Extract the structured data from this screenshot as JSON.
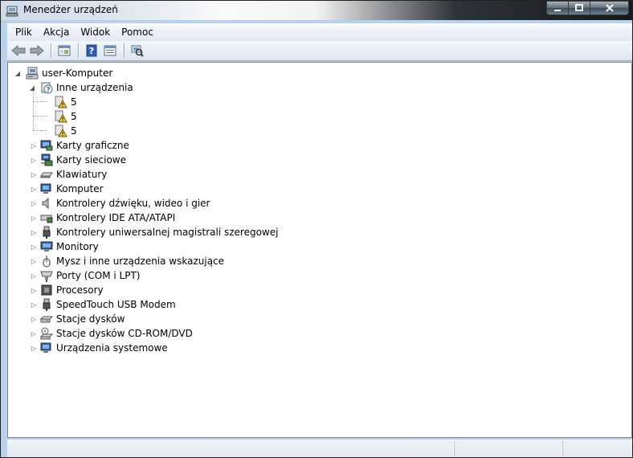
{
  "window": {
    "title": "Menedżer urządzeń",
    "caption_buttons": {
      "minimize": "▁",
      "maximize": "▢",
      "close": "✕"
    }
  },
  "menu": [
    "Plik",
    "Akcja",
    "Widok",
    "Pomoc"
  ],
  "toolbar": {
    "buttons": [
      "back-arrow-icon",
      "forward-arrow-icon",
      "console-tree-icon",
      "help-icon",
      "properties-icon",
      "scan-hardware-icon"
    ]
  },
  "tree": {
    "root": {
      "label": "user-Komputer",
      "icon": "computer-icon"
    },
    "other_devices": {
      "label": "Inne urządzenia",
      "children": [
        "5",
        "5",
        "5"
      ]
    },
    "categories": [
      {
        "label": "Karty graficzne",
        "icon": "display-adapter-icon"
      },
      {
        "label": "Karty sieciowe",
        "icon": "network-adapter-icon"
      },
      {
        "label": "Klawiatury",
        "icon": "keyboard-icon"
      },
      {
        "label": "Komputer",
        "icon": "computer-monitor-icon"
      },
      {
        "label": "Kontrolery dźwięku, wideo i gier",
        "icon": "speaker-icon"
      },
      {
        "label": "Kontrolery IDE ATA/ATAPI",
        "icon": "ide-controller-icon"
      },
      {
        "label": "Kontrolery uniwersalnej magistrali szeregowej",
        "icon": "usb-icon"
      },
      {
        "label": "Monitory",
        "icon": "monitor-icon"
      },
      {
        "label": "Mysz i inne urządzenia wskazujące",
        "icon": "mouse-icon"
      },
      {
        "label": "Porty (COM i LPT)",
        "icon": "port-icon"
      },
      {
        "label": "Procesory",
        "icon": "processor-icon"
      },
      {
        "label": "SpeedTouch USB Modem",
        "icon": "usb-modem-icon"
      },
      {
        "label": "Stacje dysków",
        "icon": "disk-drive-icon"
      },
      {
        "label": "Stacje dysków CD-ROM/DVD",
        "icon": "cdrom-icon"
      },
      {
        "label": "Urządzenia systemowe",
        "icon": "system-device-icon"
      }
    ]
  }
}
